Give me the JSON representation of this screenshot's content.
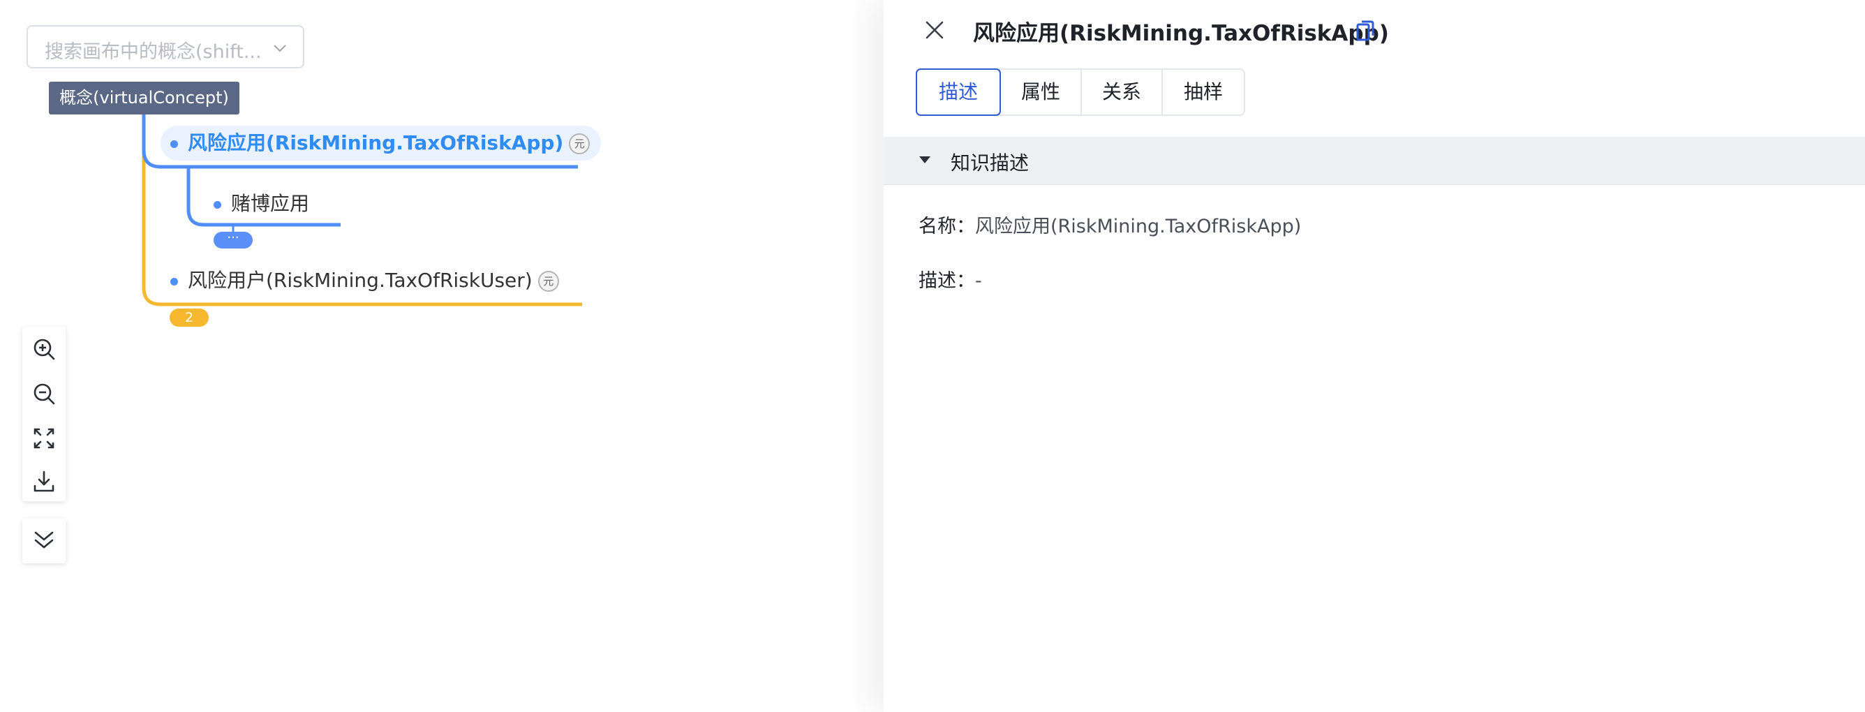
{
  "canvas": {
    "search": {
      "placeholder": "搜索画布中的概念(shift..."
    },
    "tree": {
      "root": {
        "label": "概念(virtualConcept)"
      },
      "children": [
        {
          "label": "风险应用(RiskMining.TaxOfRiskApp)",
          "badge": "元",
          "selected": true,
          "children": [
            {
              "label": "赌博应用"
            }
          ],
          "more_label": "···"
        },
        {
          "label": "风险用户(RiskMining.TaxOfRiskUser)",
          "badge": "元"
        }
      ],
      "child_count": "2"
    },
    "toolbar": [
      "zoom-in-icon",
      "zoom-out-icon",
      "fit-screen-icon",
      "download-icon"
    ],
    "collapse": "double-chevron-down-icon"
  },
  "panel": {
    "title": "风险应用(RiskMining.TaxOfRiskApp)",
    "tabs": [
      {
        "label": "描述",
        "active": true
      },
      {
        "label": "属性"
      },
      {
        "label": "关系"
      },
      {
        "label": "抽样"
      }
    ],
    "section": {
      "title": "知识描述"
    },
    "fields": [
      {
        "key": "名称：",
        "value": "风险应用(RiskMining.TaxOfRiskApp)"
      },
      {
        "key": "描述：",
        "value": "-"
      }
    ]
  },
  "colors": {
    "accent": "#2f5bd8",
    "tree_blue": "#4f8ef7",
    "tree_yellow": "#f5b82e",
    "root_bg": "#5a6785"
  }
}
